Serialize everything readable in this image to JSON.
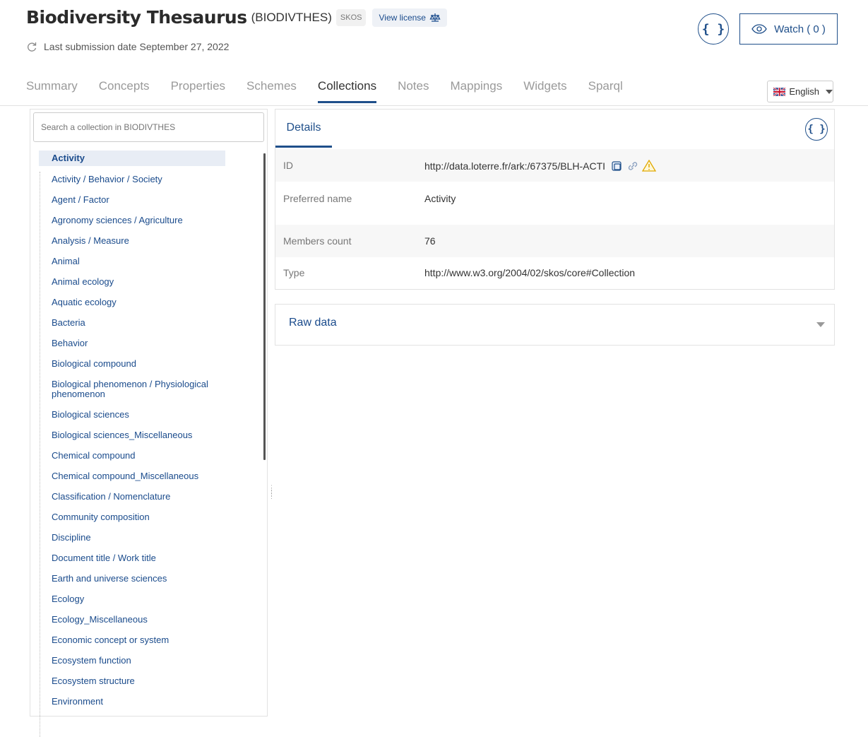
{
  "header": {
    "title": "Biodiversity Thesaurus",
    "acronym": "(BIODIVTHES)",
    "format_badge": "SKOS",
    "license_label": "View license",
    "submission_label": "Last submission date",
    "submission_date": "September 27, 2022",
    "json_label": "{ }",
    "watch_label": "Watch ( 0 )"
  },
  "tabs": [
    "Summary",
    "Concepts",
    "Properties",
    "Schemes",
    "Collections",
    "Notes",
    "Mappings",
    "Widgets",
    "Sparql"
  ],
  "active_tab": "Collections",
  "language": "English",
  "search": {
    "placeholder": "Search a collection in BIODIVTHES"
  },
  "tree": {
    "selected": "Activity",
    "items": [
      "Activity / Behavior / Society",
      "Agent / Factor",
      "Agronomy sciences / Agriculture",
      "Analysis / Measure",
      "Animal",
      "Animal ecology",
      "Aquatic ecology",
      "Bacteria",
      "Behavior",
      "Biological compound",
      "Biological phenomenon / Physiological phenomenon",
      "Biological sciences",
      "Biological sciences_Miscellaneous",
      "Chemical compound",
      "Chemical compound_Miscellaneous",
      "Classification / Nomenclature",
      "Community composition",
      "Discipline",
      "Document title / Work title",
      "Earth and universe sciences",
      "Ecology",
      "Ecology_Miscellaneous",
      "Economic concept or system",
      "Ecosystem function",
      "Ecosystem structure",
      "Environment"
    ]
  },
  "details": {
    "tab_label": "Details",
    "json_label": "{ }",
    "id_key": "ID",
    "id_value": "http://data.loterre.fr/ark:/67375/BLH-ACTI",
    "pref_key": "Preferred name",
    "pref_value": "Activity",
    "members_key": "Members count",
    "members_value": "76",
    "type_key": "Type",
    "type_value": "http://www.w3.org/2004/02/skos/core#Collection"
  },
  "raw": {
    "label": "Raw data"
  }
}
